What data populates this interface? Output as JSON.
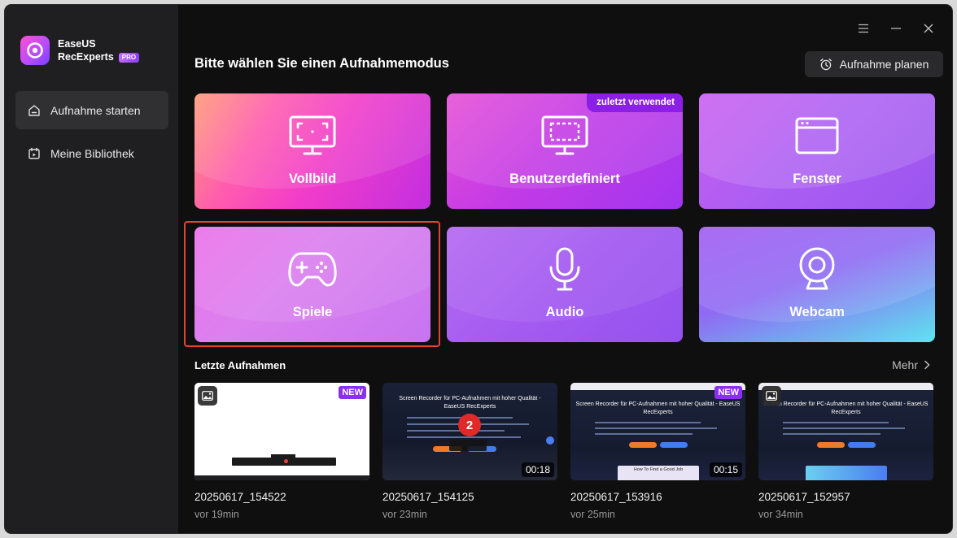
{
  "app": {
    "brand_line1": "EaseUS",
    "brand_line2": "RecExperts",
    "pro_badge": "PRO"
  },
  "sidebar": {
    "items": [
      {
        "label": "Aufnahme starten",
        "icon": "home-icon",
        "active": true
      },
      {
        "label": "Meine Bibliothek",
        "icon": "library-icon",
        "active": false
      }
    ]
  },
  "header": {
    "title": "Bitte wählen Sie einen Aufnahmemodus",
    "schedule_label": "Aufnahme planen"
  },
  "window_controls": [
    "menu-icon",
    "minimize-icon",
    "close-icon"
  ],
  "modes": [
    {
      "label": "Vollbild",
      "icon": "fullscreen-monitor-icon"
    },
    {
      "label": "Benutzerdefiniert",
      "icon": "custom-region-monitor-icon",
      "badge": "zuletzt verwendet"
    },
    {
      "label": "Fenster",
      "icon": "window-icon"
    },
    {
      "label": "Spiele",
      "icon": "gamepad-icon",
      "selected": true
    },
    {
      "label": "Audio",
      "icon": "microphone-icon"
    },
    {
      "label": "Webcam",
      "icon": "webcam-icon"
    }
  ],
  "recent": {
    "title": "Letzte Aufnahmen",
    "more_label": "Mehr",
    "items": [
      {
        "name": "20250617_154522",
        "ago": "vor 19min",
        "badge": "NEW",
        "type": "image"
      },
      {
        "name": "20250617_154125",
        "ago": "vor 23min",
        "duration": "00:18",
        "type": "video",
        "preview_title_1": "Screen Recorder für PC-Aufnahmen mit hoher Qualität -",
        "preview_title_2": "EaseUS RecExperts",
        "preview_marker": "2"
      },
      {
        "name": "20250617_153916",
        "ago": "vor 25min",
        "badge": "NEW",
        "duration": "00:15",
        "type": "video",
        "preview_title_1": "Screen Recorder für PC-Aufnahmen mit hoher Qualität - EaseUS",
        "preview_title_2": "RecExperts",
        "preview_caption": "How To Find a Good Job"
      },
      {
        "name": "20250617_152957",
        "ago": "vor 34min",
        "type": "image",
        "preview_title_1": "Screen Recorder für PC-Aufnahmen mit hoher Qualität - EaseUS",
        "preview_title_2": "RecExperts"
      }
    ]
  },
  "colors": {
    "accent_purple": "#8b1fe6",
    "selection_outline": "#e3432f",
    "sidebar_bg": "#1f1f21",
    "main_bg": "#0f0f10"
  }
}
